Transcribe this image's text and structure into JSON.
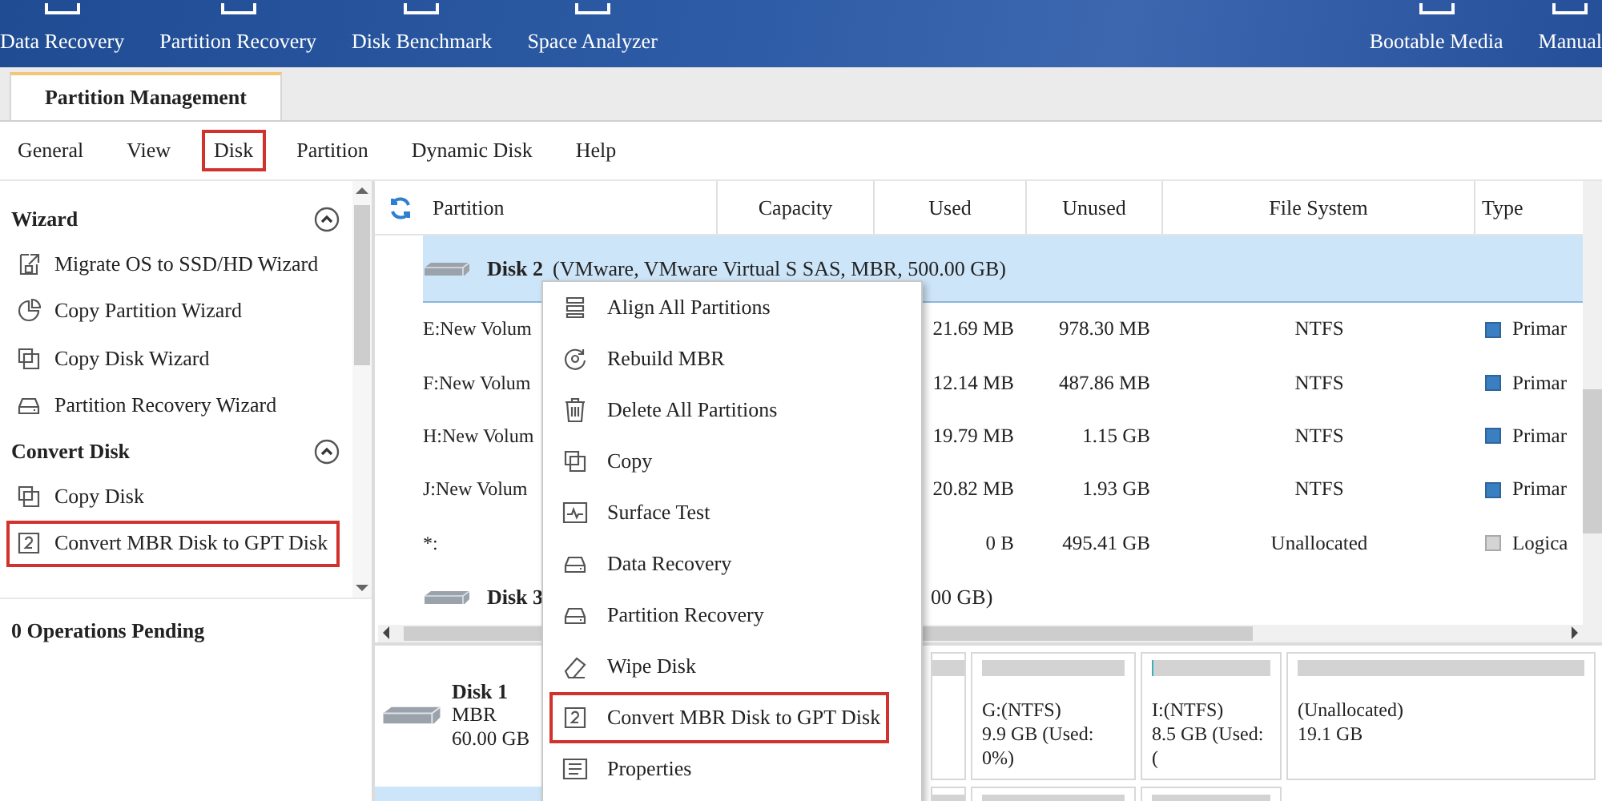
{
  "toolbar": {
    "items": [
      {
        "label": "Data Recovery"
      },
      {
        "label": "Partition Recovery"
      },
      {
        "label": "Disk Benchmark"
      },
      {
        "label": "Space Analyzer"
      }
    ],
    "right_items": [
      {
        "label": "Bootable Media"
      },
      {
        "label": "Manual"
      }
    ]
  },
  "ribbon_tabs": [
    {
      "label": "Partition Management",
      "selected": true
    }
  ],
  "menu_bar": [
    {
      "label": "General",
      "highlighted": false
    },
    {
      "label": "View",
      "highlighted": false
    },
    {
      "label": "Disk",
      "highlighted": true
    },
    {
      "label": "Partition",
      "highlighted": false
    },
    {
      "label": "Dynamic Disk",
      "highlighted": false
    },
    {
      "label": "Help",
      "highlighted": false
    }
  ],
  "sidebar": {
    "sections": [
      {
        "title": "Wizard",
        "expanded": true,
        "items": [
          {
            "label": "Migrate OS to SSD/HD Wizard",
            "highlighted": false
          },
          {
            "label": "Copy Partition Wizard",
            "highlighted": false
          },
          {
            "label": "Copy Disk Wizard",
            "highlighted": false
          },
          {
            "label": "Partition Recovery Wizard",
            "highlighted": false
          }
        ]
      },
      {
        "title": "Convert Disk",
        "expanded": true,
        "items": [
          {
            "label": "Copy Disk",
            "highlighted": false
          },
          {
            "label": "Convert MBR Disk to GPT Disk",
            "highlighted": true
          }
        ]
      }
    ],
    "pending": "0 Operations Pending"
  },
  "table": {
    "columns": [
      "Partition",
      "Capacity",
      "Used",
      "Unused",
      "File System",
      "Type"
    ],
    "rows": [
      {
        "kind": "disk",
        "name": "Disk 2",
        "details": "(VMware, VMware Virtual S SAS, MBR, 500.00 GB)",
        "selected": true
      },
      {
        "kind": "partition",
        "partition": "E:New Volum",
        "used": "21.69 MB",
        "unused": "978.30 MB",
        "file_system": "NTFS",
        "type": "Primar",
        "color": "#3a7fc2"
      },
      {
        "kind": "partition",
        "partition": "F:New Volum",
        "used": "12.14 MB",
        "unused": "487.86 MB",
        "file_system": "NTFS",
        "type": "Primar",
        "color": "#3a7fc2"
      },
      {
        "kind": "partition",
        "partition": "H:New Volum",
        "used": "19.79 MB",
        "unused": "1.15 GB",
        "file_system": "NTFS",
        "type": "Primar",
        "color": "#3a7fc2"
      },
      {
        "kind": "partition",
        "partition": "J:New Volum",
        "used": "20.82 MB",
        "unused": "1.93 GB",
        "file_system": "NTFS",
        "type": "Primar",
        "color": "#3a7fc2"
      },
      {
        "kind": "partition",
        "partition": "*:",
        "used": "0 B",
        "unused": "495.41 GB",
        "file_system": "Unallocated",
        "type": "Logica",
        "color": "#d4d4d4"
      },
      {
        "kind": "disk",
        "name": "Disk 3",
        "tail": "00 GB)",
        "selected": false
      }
    ]
  },
  "disk_map": {
    "disks": [
      {
        "name": "Disk 1",
        "style": "MBR",
        "size": "60.00 GB",
        "selected": false,
        "partitions": [
          {
            "label": "G:(NTFS)",
            "size": "9.9 GB (Used: 0%)"
          },
          {
            "label": "I:(NTFS)",
            "size": "8.5 GB (Used: (",
            "level": 0.02
          },
          {
            "label": "(Unallocated)",
            "size": "19.1 GB"
          }
        ]
      },
      {
        "selected": true
      }
    ]
  },
  "context_menu": [
    {
      "label": "Align All Partitions",
      "highlighted": false
    },
    {
      "label": "Rebuild MBR",
      "highlighted": false
    },
    {
      "label": "Delete All Partitions",
      "highlighted": false
    },
    {
      "label": "Copy",
      "highlighted": false
    },
    {
      "label": "Surface Test",
      "highlighted": false
    },
    {
      "label": "Data Recovery",
      "highlighted": false
    },
    {
      "label": "Partition Recovery",
      "highlighted": false
    },
    {
      "label": "Wipe Disk",
      "highlighted": false
    },
    {
      "label": "Convert MBR Disk to GPT Disk",
      "highlighted": true
    },
    {
      "label": "Properties",
      "highlighted": false
    }
  ]
}
